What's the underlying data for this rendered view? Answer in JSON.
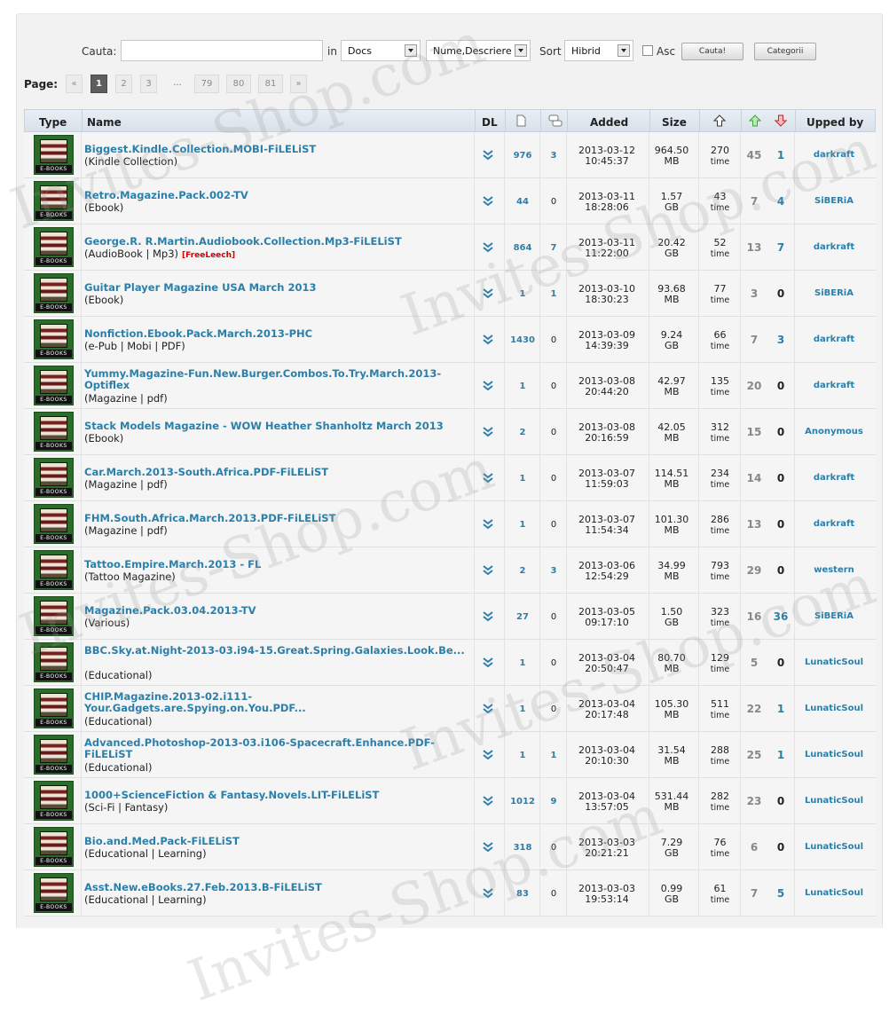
{
  "search": {
    "label": "Cauta:",
    "value": "",
    "in_label": "in",
    "scope": "Docs",
    "field": "Nume,Descriere",
    "sort_label": "Sort",
    "sort": "Hibrid",
    "asc_label": "Asc",
    "search_button": "Cauta!",
    "categories_button": "Categorii"
  },
  "pager": {
    "label": "Page:",
    "items": [
      "«",
      "1",
      "2",
      "3",
      "...",
      "79",
      "80",
      "81",
      "»"
    ],
    "active": "1"
  },
  "columns": [
    "Type",
    "Name",
    "DL",
    "",
    "",
    "Added",
    "Size",
    "",
    "",
    "",
    "Upped by"
  ],
  "badge": "E-BOOKS",
  "time_unit": "time",
  "rows": [
    {
      "name": "Biggest.Kindle.Collection.MOBI-FiLELiST",
      "cat": "(Kindle Collection)",
      "free": "",
      "files": "976",
      "comments": "3",
      "date": "2013-03-12",
      "time": "10:45:37",
      "size": "964.50",
      "unit": "MB",
      "done": "270",
      "seeders": "45",
      "leechers": "1",
      "upper": "darkraft"
    },
    {
      "name": "Retro.Magazine.Pack.002-TV",
      "cat": "(Ebook)",
      "free": "",
      "files": "44",
      "comments": "0",
      "date": "2013-03-11",
      "time": "18:28:06",
      "size": "1.57",
      "unit": "GB",
      "done": "43",
      "seeders": "7",
      "leechers": "4",
      "upper": "SiBERiA"
    },
    {
      "name": "George.R. R.Martin.Audiobook.Collection.Mp3-FiLELiST",
      "cat": "(AudioBook | Mp3)",
      "free": "[FreeLeech]",
      "files": "864",
      "comments": "7",
      "date": "2013-03-11",
      "time": "11:22:00",
      "size": "20.42",
      "unit": "GB",
      "done": "52",
      "seeders": "13",
      "leechers": "7",
      "upper": "darkraft"
    },
    {
      "name": "Guitar Player Magazine USA March 2013",
      "cat": "(Ebook)",
      "free": "",
      "files": "1",
      "comments": "1",
      "date": "2013-03-10",
      "time": "18:30:23",
      "size": "93.68",
      "unit": "MB",
      "done": "77",
      "seeders": "3",
      "leechers": "0",
      "upper": "SiBERiA"
    },
    {
      "name": "Nonfiction.Ebook.Pack.March.2013-PHC",
      "cat": "(e-Pub | Mobi | PDF)",
      "free": "",
      "files": "1430",
      "comments": "0",
      "date": "2013-03-09",
      "time": "14:39:39",
      "size": "9.24",
      "unit": "GB",
      "done": "66",
      "seeders": "7",
      "leechers": "3",
      "upper": "darkraft"
    },
    {
      "name": "Yummy.Magazine-Fun.New.Burger.Combos.To.Try.March.2013-Optiflex",
      "cat": "(Magazine | pdf)",
      "free": "",
      "files": "1",
      "comments": "0",
      "date": "2013-03-08",
      "time": "20:44:20",
      "size": "42.97",
      "unit": "MB",
      "done": "135",
      "seeders": "20",
      "leechers": "0",
      "upper": "darkraft"
    },
    {
      "name": "Stack Models Magazine - WOW Heather Shanholtz March 2013",
      "cat": "(Ebook)",
      "free": "",
      "files": "2",
      "comments": "0",
      "date": "2013-03-08",
      "time": "20:16:59",
      "size": "42.05",
      "unit": "MB",
      "done": "312",
      "seeders": "15",
      "leechers": "0",
      "upper": "Anonymous"
    },
    {
      "name": "Car.March.2013-South.Africa.PDF-FiLELiST",
      "cat": "(Magazine | pdf)",
      "free": "",
      "files": "1",
      "comments": "0",
      "date": "2013-03-07",
      "time": "11:59:03",
      "size": "114.51",
      "unit": "MB",
      "done": "234",
      "seeders": "14",
      "leechers": "0",
      "upper": "darkraft"
    },
    {
      "name": "FHM.South.Africa.March.2013.PDF-FiLELiST",
      "cat": "(Magazine | pdf)",
      "free": "",
      "files": "1",
      "comments": "0",
      "date": "2013-03-07",
      "time": "11:54:34",
      "size": "101.30",
      "unit": "MB",
      "done": "286",
      "seeders": "13",
      "leechers": "0",
      "upper": "darkraft"
    },
    {
      "name": "Tattoo.Empire.March.2013 - FL",
      "cat": "(Tattoo Magazine)",
      "free": "",
      "files": "2",
      "comments": "3",
      "date": "2013-03-06",
      "time": "12:54:29",
      "size": "34.99",
      "unit": "MB",
      "done": "793",
      "seeders": "29",
      "leechers": "0",
      "upper": "western"
    },
    {
      "name": "Magazine.Pack.03.04.2013-TV",
      "cat": "(Various)",
      "free": "",
      "files": "27",
      "comments": "0",
      "date": "2013-03-05",
      "time": "09:17:10",
      "size": "1.50",
      "unit": "GB",
      "done": "323",
      "seeders": "16",
      "leechers": "36",
      "upper": "SiBERiA"
    },
    {
      "name": "BBC.Sky.at.Night-2013-03.i94-15.Great.Spring.Galaxies.Look.Be...",
      "cat": "(Educational)",
      "free": "",
      "files": "1",
      "comments": "0",
      "date": "2013-03-04",
      "time": "20:50:47",
      "size": "80.70",
      "unit": "MB",
      "done": "129",
      "seeders": "5",
      "leechers": "0",
      "upper": "LunaticSoul"
    },
    {
      "name": "CHIP.Magazine.2013-02.i111-Your.Gadgets.are.Spying.on.You.PDF...",
      "cat": "(Educational)",
      "free": "",
      "files": "1",
      "comments": "0",
      "date": "2013-03-04",
      "time": "20:17:48",
      "size": "105.30",
      "unit": "MB",
      "done": "511",
      "seeders": "22",
      "leechers": "1",
      "upper": "LunaticSoul"
    },
    {
      "name": "Advanced.Photoshop-2013-03.i106-Spacecraft.Enhance.PDF-FiLELiST",
      "cat": "(Educational)",
      "free": "",
      "files": "1",
      "comments": "1",
      "date": "2013-03-04",
      "time": "20:10:30",
      "size": "31.54",
      "unit": "MB",
      "done": "288",
      "seeders": "25",
      "leechers": "1",
      "upper": "LunaticSoul"
    },
    {
      "name": "1000+ScienceFiction & Fantasy.Novels.LIT-FiLELiST",
      "cat": "(Sci-Fi | Fantasy)",
      "free": "",
      "files": "1012",
      "comments": "9",
      "date": "2013-03-04",
      "time": "13:57:05",
      "size": "531.44",
      "unit": "MB",
      "done": "282",
      "seeders": "23",
      "leechers": "0",
      "upper": "LunaticSoul"
    },
    {
      "name": "Bio.and.Med.Pack-FiLELiST",
      "cat": "(Educational | Learning)",
      "free": "",
      "files": "318",
      "comments": "0",
      "date": "2013-03-03",
      "time": "20:21:21",
      "size": "7.29",
      "unit": "GB",
      "done": "76",
      "seeders": "6",
      "leechers": "0",
      "upper": "LunaticSoul"
    },
    {
      "name": "Asst.New.eBooks.27.Feb.2013.B-FiLELiST",
      "cat": "(Educational | Learning)",
      "free": "",
      "files": "83",
      "comments": "0",
      "date": "2013-03-03",
      "time": "19:53:14",
      "size": "0.99",
      "unit": "GB",
      "done": "61",
      "seeders": "7",
      "leechers": "5",
      "upper": "LunaticSoul"
    }
  ],
  "watermark": "Invites-Shop.com",
  "colors": {
    "link": "#2c7fa8",
    "free": "#d40000",
    "seed_icon": "#3aa63a",
    "leech_icon": "#cc2222"
  }
}
